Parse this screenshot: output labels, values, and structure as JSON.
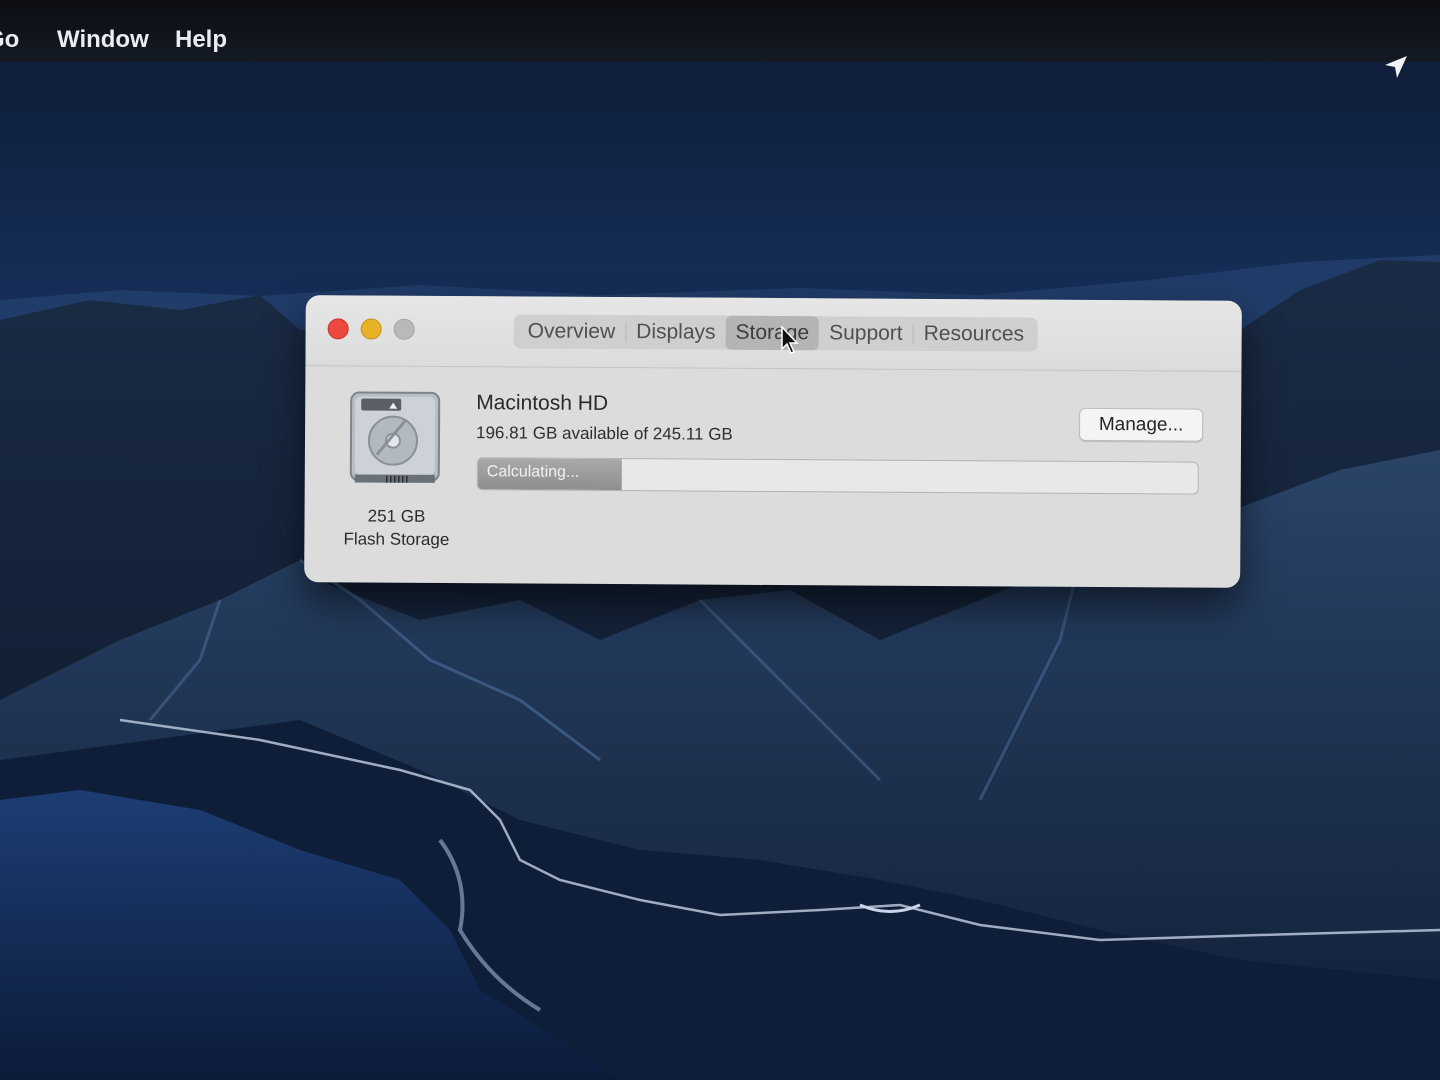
{
  "menubar": {
    "items": [
      "Go",
      "Window",
      "Help"
    ],
    "status_icons": [
      "location-arrow-icon"
    ]
  },
  "window": {
    "tabs": [
      "Overview",
      "Displays",
      "Storage",
      "Support",
      "Resources"
    ],
    "selected_tab": "Storage",
    "drive": {
      "icon": "hard-drive-icon",
      "capacity": "251 GB",
      "type": "Flash Storage"
    },
    "volume": {
      "name": "Macintosh HD",
      "availability": "196.81 GB available of 245.11 GB",
      "bar_status": "Calculating...",
      "bar_fill_fraction": 0.2
    },
    "manage_button": "Manage..."
  },
  "colors": {
    "close": "#ec4a3f",
    "minimize": "#e8b227",
    "zoom_inactive": "#b9b9b9"
  }
}
